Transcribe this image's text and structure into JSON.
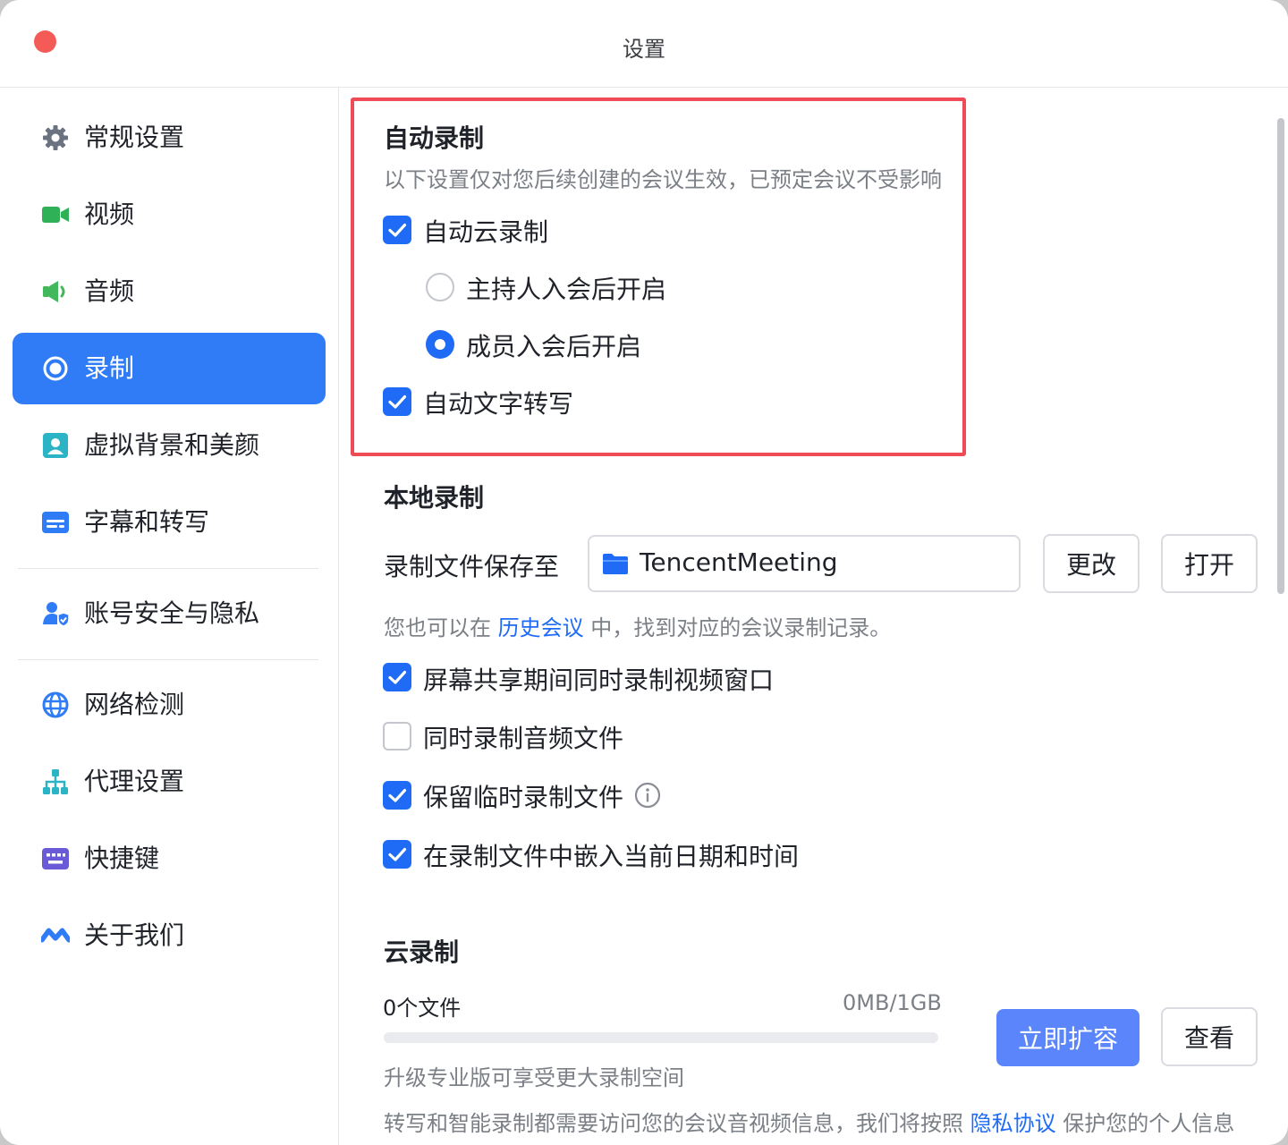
{
  "window": {
    "title": "设置"
  },
  "sidebar": {
    "items": [
      {
        "label": "常规设置",
        "icon": "gear-icon"
      },
      {
        "label": "视频",
        "icon": "video-camera-icon"
      },
      {
        "label": "音频",
        "icon": "speaker-icon"
      },
      {
        "label": "录制",
        "icon": "record-icon",
        "active": true
      },
      {
        "label": "虚拟背景和美颜",
        "icon": "portrait-icon"
      },
      {
        "label": "字幕和转写",
        "icon": "subtitles-icon"
      },
      {
        "label": "账号安全与隐私",
        "icon": "user-shield-icon"
      },
      {
        "label": "网络检测",
        "icon": "globe-icon"
      },
      {
        "label": "代理设置",
        "icon": "network-tree-icon"
      },
      {
        "label": "快捷键",
        "icon": "keyboard-icon"
      },
      {
        "label": "关于我们",
        "icon": "tencent-meeting-logo-icon"
      }
    ]
  },
  "auto_record": {
    "title": "自动录制",
    "note": "以下设置仅对您后续创建的会议生效，已预定会议不受影响",
    "cloud_label": "自动云录制",
    "cloud_checked": true,
    "radio_host": "主持人入会后开启",
    "radio_member": "成员入会后开启",
    "selected": "成员入会后开启",
    "transcribe_label": "自动文字转写",
    "transcribe_checked": true
  },
  "local_record": {
    "title": "本地录制",
    "save_to_label": "录制文件保存至",
    "path": "TencentMeeting",
    "change_button": "更改",
    "open_button": "打开",
    "history_prefix": "您也可以在",
    "history_link": "历史会议",
    "history_suffix": "中，找到对应的会议录制记录。",
    "options": [
      {
        "label": "屏幕共享期间同时录制视频窗口",
        "checked": true
      },
      {
        "label": "同时录制音频文件",
        "checked": false
      },
      {
        "label": "保留临时录制文件",
        "checked": true
      },
      {
        "label": "在录制文件中嵌入当前日期和时间",
        "checked": true
      }
    ]
  },
  "cloud_record": {
    "title": "云录制",
    "files_count": "0个文件",
    "usage": "0MB/1GB",
    "usage_fraction": 0,
    "expand_button": "立即扩容",
    "view_button": "查看",
    "upgrade_hint": "升级专业版可享受更大录制空间",
    "privacy_prefix": "转写和智能录制都需要访问您的会议音视频信息，我们将按照",
    "privacy_link": "隐私协议",
    "privacy_suffix": "保护您的个人信息"
  },
  "colors": {
    "accent": "#1f6bf5",
    "sidebar_active": "#2f7cf6",
    "highlight_border": "#ef4b56",
    "primary_button": "#5b86fb"
  }
}
